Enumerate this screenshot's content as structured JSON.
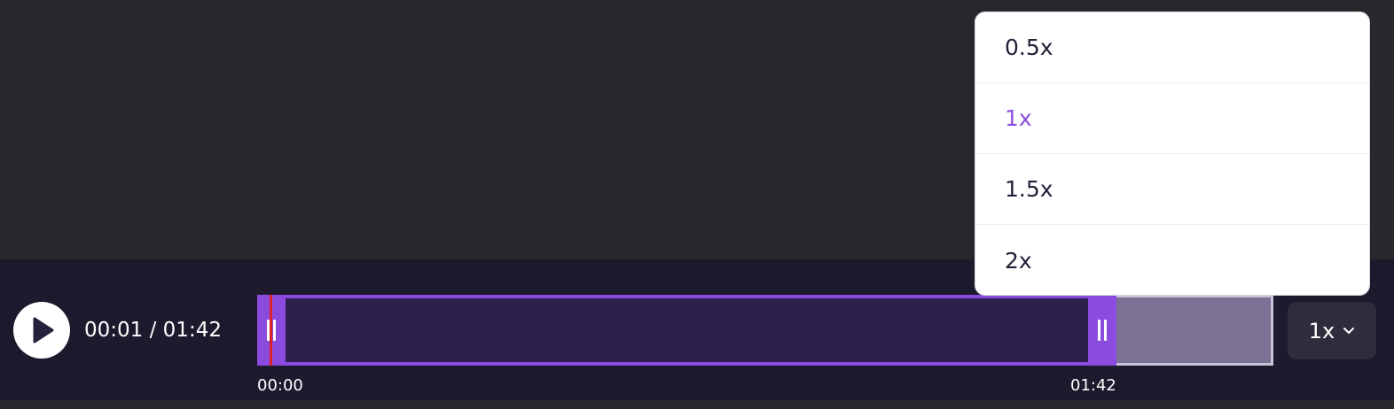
{
  "player": {
    "current_time": "00:01",
    "separator": " / ",
    "duration": "01:42"
  },
  "timeline": {
    "start_label": "00:00",
    "end_label": "01:42",
    "trim_start_time": "00:00",
    "trim_end_time": "01:42",
    "playhead_time": "00:01"
  },
  "speed": {
    "current_label": "1x",
    "options": [
      "0.5x",
      "1x",
      "1.5x",
      "2x"
    ],
    "selected_index": 1
  },
  "icons": {
    "play": "play-icon",
    "dropdown": "chevron-down-icon",
    "handle": "grip-icon"
  },
  "colors": {
    "accent": "#8b4bdf",
    "playhead": "#e0202a",
    "panel_bg": "#1e1a2e",
    "stage_bg": "#27272c"
  }
}
